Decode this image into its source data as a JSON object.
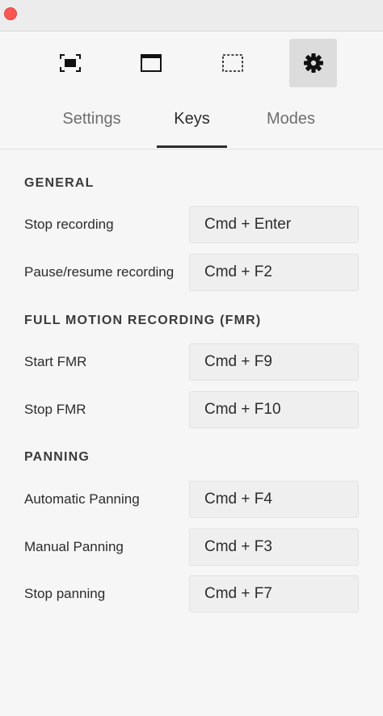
{
  "window": {
    "close_button": "close"
  },
  "toolbar": {
    "items": [
      {
        "icon": "fullscreen-capture-icon"
      },
      {
        "icon": "window-capture-icon"
      },
      {
        "icon": "region-capture-icon"
      },
      {
        "icon": "gear-icon",
        "active": true
      }
    ]
  },
  "tabs": [
    {
      "label": "Settings",
      "active": false
    },
    {
      "label": "Keys",
      "active": true
    },
    {
      "label": "Modes",
      "active": false
    }
  ],
  "sections": [
    {
      "title": "GENERAL",
      "rows": [
        {
          "label": "Stop recording",
          "shortcut": "Cmd + Enter"
        },
        {
          "label": "Pause/resume recording",
          "shortcut": "Cmd + F2"
        }
      ]
    },
    {
      "title": "FULL MOTION RECORDING (FMR)",
      "rows": [
        {
          "label": "Start FMR",
          "shortcut": "Cmd + F9"
        },
        {
          "label": "Stop FMR",
          "shortcut": "Cmd + F10"
        }
      ]
    },
    {
      "title": "PANNING",
      "rows": [
        {
          "label": "Automatic Panning",
          "shortcut": "Cmd + F4"
        },
        {
          "label": "Manual Panning",
          "shortcut": "Cmd + F3"
        },
        {
          "label": "Stop panning",
          "shortcut": "Cmd + F7"
        }
      ]
    }
  ],
  "colors": {
    "close": "#fc5753",
    "active_tool_bg": "#dcdcdc",
    "background": "#f6f6f6"
  }
}
